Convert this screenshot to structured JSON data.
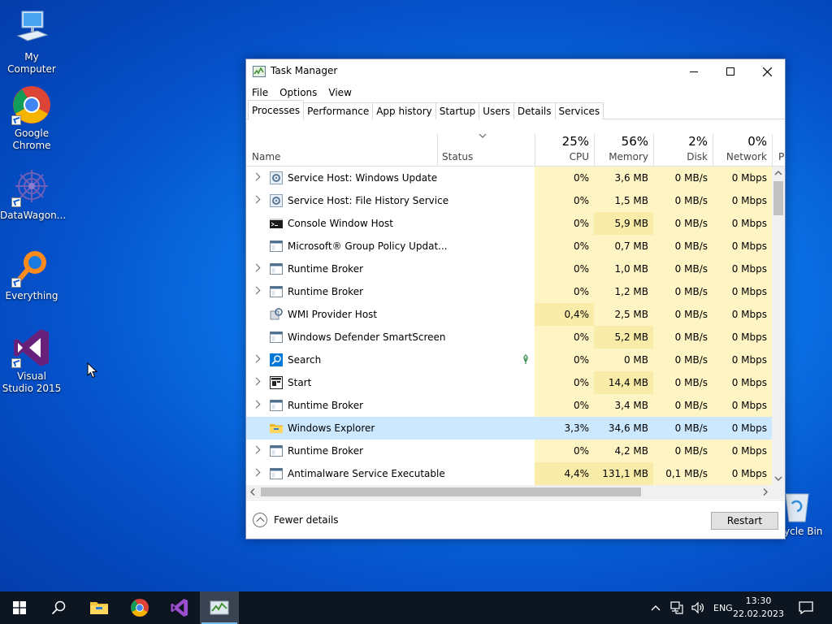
{
  "desktop": {
    "icons": [
      {
        "label": "My Computer"
      },
      {
        "label": "Google Chrome"
      },
      {
        "label": "DataWagon..."
      },
      {
        "label": "Everything"
      },
      {
        "label": "Visual Studio 2015"
      },
      {
        "label": "ycle Bin"
      }
    ]
  },
  "window": {
    "title": "Task Manager",
    "menu": [
      "File",
      "Options",
      "View"
    ],
    "tabs": [
      "Processes",
      "Performance",
      "App history",
      "Startup",
      "Users",
      "Details",
      "Services"
    ],
    "columns": {
      "name": "Name",
      "status": "Status",
      "cpu": {
        "label": "CPU",
        "pct": "25%"
      },
      "memory": {
        "label": "Memory",
        "pct": "56%"
      },
      "disk": {
        "label": "Disk",
        "pct": "2%"
      },
      "network": {
        "label": "Network",
        "pct": "0%"
      },
      "power": "P"
    },
    "rows": [
      {
        "name": "Service Host: Windows Update",
        "cpu": "0%",
        "mem": "3,6 MB",
        "disk": "0 MB/s",
        "net": "0 Mbps",
        "icon": "gear-icon",
        "expandable": true
      },
      {
        "name": "Service Host: File History Service",
        "cpu": "0%",
        "mem": "1,5 MB",
        "disk": "0 MB/s",
        "net": "0 Mbps",
        "icon": "gear-icon",
        "expandable": true
      },
      {
        "name": "Console Window Host",
        "cpu": "0%",
        "mem": "5,9 MB",
        "disk": "0 MB/s",
        "net": "0 Mbps",
        "icon": "console-icon",
        "expandable": false
      },
      {
        "name": "Microsoft® Group Policy Updat...",
        "cpu": "0%",
        "mem": "0,7 MB",
        "disk": "0 MB/s",
        "net": "0 Mbps",
        "icon": "window-icon",
        "expandable": false
      },
      {
        "name": "Runtime Broker",
        "cpu": "0%",
        "mem": "1,0 MB",
        "disk": "0 MB/s",
        "net": "0 Mbps",
        "icon": "window-icon",
        "expandable": true
      },
      {
        "name": "Runtime Broker",
        "cpu": "0%",
        "mem": "1,2 MB",
        "disk": "0 MB/s",
        "net": "0 Mbps",
        "icon": "window-icon",
        "expandable": true
      },
      {
        "name": "WMI Provider Host",
        "cpu": "0,4%",
        "mem": "2,5 MB",
        "disk": "0 MB/s",
        "net": "0 Mbps",
        "icon": "wmi-icon",
        "expandable": false
      },
      {
        "name": "Windows Defender SmartScreen",
        "cpu": "0%",
        "mem": "5,2 MB",
        "disk": "0 MB/s",
        "net": "0 Mbps",
        "icon": "window-icon",
        "expandable": false
      },
      {
        "name": "Search",
        "cpu": "0%",
        "mem": "0 MB",
        "disk": "0 MB/s",
        "net": "0 Mbps",
        "icon": "search-icon",
        "expandable": true,
        "leaf": true
      },
      {
        "name": "Start",
        "cpu": "0%",
        "mem": "14,4 MB",
        "disk": "0 MB/s",
        "net": "0 Mbps",
        "icon": "start-app-icon",
        "expandable": true
      },
      {
        "name": "Runtime Broker",
        "cpu": "0%",
        "mem": "3,4 MB",
        "disk": "0 MB/s",
        "net": "0 Mbps",
        "icon": "window-icon",
        "expandable": true
      },
      {
        "name": "Windows Explorer",
        "cpu": "3,3%",
        "mem": "34,6 MB",
        "disk": "0 MB/s",
        "net": "0 Mbps",
        "icon": "folder-icon",
        "expandable": false,
        "selected": true
      },
      {
        "name": "Runtime Broker",
        "cpu": "0%",
        "mem": "4,2 MB",
        "disk": "0 MB/s",
        "net": "0 Mbps",
        "icon": "window-icon",
        "expandable": true
      },
      {
        "name": "Antimalware Service Executable",
        "cpu": "4,4%",
        "mem": "131,1 MB",
        "disk": "0,1 MB/s",
        "net": "0 Mbps",
        "icon": "window-icon",
        "expandable": true
      }
    ],
    "fewer_details": "Fewer details",
    "restart": "Restart"
  },
  "taskbar": {
    "lang": "ENG",
    "time": "13:30",
    "date": "22.02.2023"
  },
  "colors": {
    "heat_light": "#fff4c4",
    "heat_mid": "#f9eca8",
    "selected": "#cce8ff",
    "accent": "#0078d7"
  }
}
